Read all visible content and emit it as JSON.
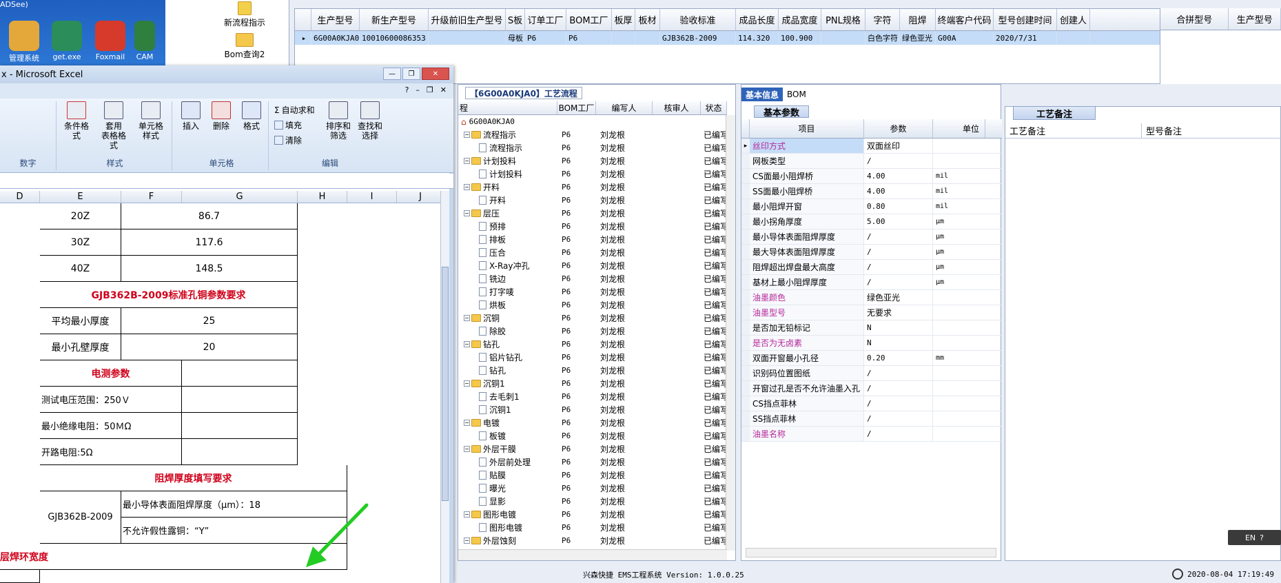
{
  "desktop": {
    "title_fragment": "ADSee)",
    "icons": [
      {
        "label": "管理系统"
      },
      {
        "label": "get.exe"
      },
      {
        "label": "Foxmail"
      },
      {
        "label": "CAM"
      }
    ]
  },
  "flow_buttons": [
    {
      "label": "新流程指示"
    },
    {
      "label": "Bom查询2"
    }
  ],
  "top_grid": {
    "columns": [
      "生产型号",
      "新生产型号",
      "升级前旧生产型号",
      "S板",
      "订单工厂",
      "BOM工厂",
      "板厚",
      "板材",
      "验收标准",
      "成品长度",
      "成品宽度",
      "PNL规格",
      "字符",
      "阻焊",
      "终端客户代码",
      "型号创建时间",
      "创建人"
    ],
    "row": [
      "6G00A0KJA0",
      "10010600086353",
      "",
      "母板",
      "P6",
      "P6",
      "",
      "",
      "GJB362B-2009",
      "114.320",
      "100.900",
      "",
      "白色字符",
      "绿色亚光",
      "G00A",
      "2020/7/31",
      ""
    ],
    "right_columns": [
      "合拼型号",
      "生产型号"
    ]
  },
  "flow_tree": {
    "tab_label": "【6G00A0KJA0】工艺流程",
    "columns": [
      "程",
      "BOM工厂",
      "编写人",
      "核审人",
      "状态"
    ],
    "root": "6G00A0KJA0",
    "rows": [
      {
        "type": "folder",
        "name": "流程指示",
        "factory": "P6",
        "writer": "刘龙根",
        "status": "已编写"
      },
      {
        "type": "doc",
        "name": "流程指示",
        "factory": "P6",
        "writer": "刘龙根",
        "status": "已编写"
      },
      {
        "type": "folder",
        "name": "计划投料",
        "factory": "P6",
        "writer": "刘龙根",
        "status": "已编写"
      },
      {
        "type": "doc",
        "name": "计划投料",
        "factory": "P6",
        "writer": "刘龙根",
        "status": "已编写"
      },
      {
        "type": "folder",
        "name": "开料",
        "factory": "P6",
        "writer": "刘龙根",
        "status": "已编写"
      },
      {
        "type": "doc",
        "name": "开料",
        "factory": "P6",
        "writer": "刘龙根",
        "status": "已编写"
      },
      {
        "type": "folder",
        "name": "层压",
        "factory": "P6",
        "writer": "刘龙根",
        "status": "已编写"
      },
      {
        "type": "doc",
        "name": "预排",
        "factory": "P6",
        "writer": "刘龙根",
        "status": "已编写"
      },
      {
        "type": "doc",
        "name": "排板",
        "factory": "P6",
        "writer": "刘龙根",
        "status": "已编写"
      },
      {
        "type": "doc",
        "name": "压合",
        "factory": "P6",
        "writer": "刘龙根",
        "status": "已编写"
      },
      {
        "type": "doc",
        "name": "X-Ray冲孔",
        "factory": "P6",
        "writer": "刘龙根",
        "status": "已编写"
      },
      {
        "type": "doc",
        "name": "铣边",
        "factory": "P6",
        "writer": "刘龙根",
        "status": "已编写"
      },
      {
        "type": "doc",
        "name": "打字唛",
        "factory": "P6",
        "writer": "刘龙根",
        "status": "已编写"
      },
      {
        "type": "doc",
        "name": "烘板",
        "factory": "P6",
        "writer": "刘龙根",
        "status": "已编写"
      },
      {
        "type": "folder",
        "name": "沉铜",
        "factory": "P6",
        "writer": "刘龙根",
        "status": "已编写"
      },
      {
        "type": "doc",
        "name": "除胶",
        "factory": "P6",
        "writer": "刘龙根",
        "status": "已编写"
      },
      {
        "type": "folder",
        "name": "钻孔",
        "factory": "P6",
        "writer": "刘龙根",
        "status": "已编写"
      },
      {
        "type": "doc",
        "name": "铝片钻孔",
        "factory": "P6",
        "writer": "刘龙根",
        "status": "已编写"
      },
      {
        "type": "doc",
        "name": "钻孔",
        "factory": "P6",
        "writer": "刘龙根",
        "status": "已编写"
      },
      {
        "type": "folder",
        "name": "沉铜1",
        "factory": "P6",
        "writer": "刘龙根",
        "status": "已编写"
      },
      {
        "type": "doc",
        "name": "去毛刺1",
        "factory": "P6",
        "writer": "刘龙根",
        "status": "已编写"
      },
      {
        "type": "doc",
        "name": "沉铜1",
        "factory": "P6",
        "writer": "刘龙根",
        "status": "已编写"
      },
      {
        "type": "folder",
        "name": "电镀",
        "factory": "P6",
        "writer": "刘龙根",
        "status": "已编写"
      },
      {
        "type": "doc",
        "name": "板镀",
        "factory": "P6",
        "writer": "刘龙根",
        "status": "已编写"
      },
      {
        "type": "folder",
        "name": "外层干膜",
        "factory": "P6",
        "writer": "刘龙根",
        "status": "已编写"
      },
      {
        "type": "doc",
        "name": "外层前处理",
        "factory": "P6",
        "writer": "刘龙根",
        "status": "已编写"
      },
      {
        "type": "doc",
        "name": "贴膜",
        "factory": "P6",
        "writer": "刘龙根",
        "status": "已编写"
      },
      {
        "type": "doc",
        "name": "曝光",
        "factory": "P6",
        "writer": "刘龙根",
        "status": "已编写"
      },
      {
        "type": "doc",
        "name": "显影",
        "factory": "P6",
        "writer": "刘龙根",
        "status": "已编写"
      },
      {
        "type": "folder",
        "name": "图形电镀",
        "factory": "P6",
        "writer": "刘龙根",
        "status": "已编写"
      },
      {
        "type": "doc",
        "name": "图形电镀",
        "factory": "P6",
        "writer": "刘龙根",
        "status": "已编写"
      },
      {
        "type": "folder",
        "name": "外层蚀刻",
        "factory": "P6",
        "writer": "刘龙根",
        "status": "已编写"
      }
    ]
  },
  "basic_info": {
    "tabs": [
      "基本信息",
      "BOM"
    ],
    "subtab": "基本参数",
    "columns": [
      "项目",
      "参数",
      "单位"
    ],
    "rows": [
      {
        "item": "丝印方式",
        "value": "双面丝印",
        "unit": "",
        "pink": true
      },
      {
        "item": "网板类型",
        "value": "/",
        "unit": ""
      },
      {
        "item": "CS面最小阻焊桥",
        "value": "4.00",
        "unit": "mil"
      },
      {
        "item": "SS面最小阻焊桥",
        "value": "4.00",
        "unit": "mil"
      },
      {
        "item": "最小阻焊开窗",
        "value": "0.80",
        "unit": "mil"
      },
      {
        "item": "最小拐角厚度",
        "value": "5.00",
        "unit": "μm"
      },
      {
        "item": "最小导体表面阻焊厚度",
        "value": "/",
        "unit": "μm"
      },
      {
        "item": "最大导体表面阻焊厚度",
        "value": "/",
        "unit": "μm"
      },
      {
        "item": "阻焊超出焊盘最大高度",
        "value": "/",
        "unit": "μm"
      },
      {
        "item": "基材上最小阻焊厚度",
        "value": "/",
        "unit": "μm"
      },
      {
        "item": "油墨颜色",
        "value": "绿色亚光",
        "unit": "",
        "pink": true
      },
      {
        "item": "油墨型号",
        "value": "无要求",
        "unit": "",
        "pink": true
      },
      {
        "item": "是否加无铅标记",
        "value": "N",
        "unit": ""
      },
      {
        "item": "是否为无卤素",
        "value": "N",
        "unit": "",
        "pink": true
      },
      {
        "item": "双面开窗最小孔径",
        "value": "0.20",
        "unit": "mm"
      },
      {
        "item": "识别码位置图纸",
        "value": "/",
        "unit": ""
      },
      {
        "item": "开窗过孔是否不允许油墨入孔",
        "value": "/",
        "unit": ""
      },
      {
        "item": "CS挡点菲林",
        "value": "/",
        "unit": ""
      },
      {
        "item": "SS挡点菲林",
        "value": "/",
        "unit": ""
      },
      {
        "item": "油墨名称",
        "value": "/",
        "unit": "",
        "pink": true
      }
    ]
  },
  "notes": {
    "tab": "工艺备注",
    "columns": [
      "工艺备注",
      "型号备注"
    ]
  },
  "status": {
    "version": "兴森快捷 EMS工程系统 Version: 1.0.0.25",
    "datetime": "2020-08-04 17:19:49",
    "lang": "EN"
  },
  "excel": {
    "title": "x - Microsoft Excel",
    "ribbon": {
      "autosum": "自动求和",
      "fill": "填充",
      "clear": "清除",
      "cond_format": "条件格式",
      "table_format": "套用\n表格格式",
      "cell_style": "单元格\n样式",
      "insert": "插入",
      "delete": "删除",
      "format": "格式",
      "sort_filter": "排序和\n筛选",
      "find_select": "查找和\n选择",
      "group_number": "数字",
      "group_style": "样式",
      "group_cells": "单元格",
      "group_edit": "编辑"
    },
    "col_headers": [
      "D",
      "E",
      "F",
      "G",
      "H",
      "I",
      "J"
    ],
    "cells": {
      "r1_e": "20Z",
      "r1_g": "86.7",
      "r2_e": "30Z",
      "r2_g": "117.6",
      "r3_e": "40Z",
      "r3_g": "148.5",
      "title_hole": "GJB362B-2009标准孔铜参数要求",
      "avg_label": "平均最小厚度",
      "avg_val": "25",
      "min_wall_label": "最小孔壁厚度",
      "min_wall_val": "20",
      "elec_title": "电测参数",
      "volt": "测试电压范围：250Ｖ",
      "insul": "最小绝缘电阻：50ＭΩ",
      "open": "开路电阻:5Ω",
      "sm_title": "阻焊厚度填写要求",
      "std": "GJB362B-2009",
      "sm_req": "最小导体表面阻焊厚度（μm）：18",
      "no_copper": "不允许假性露铜：“Y”",
      "ring": "层焊环宽度"
    }
  }
}
